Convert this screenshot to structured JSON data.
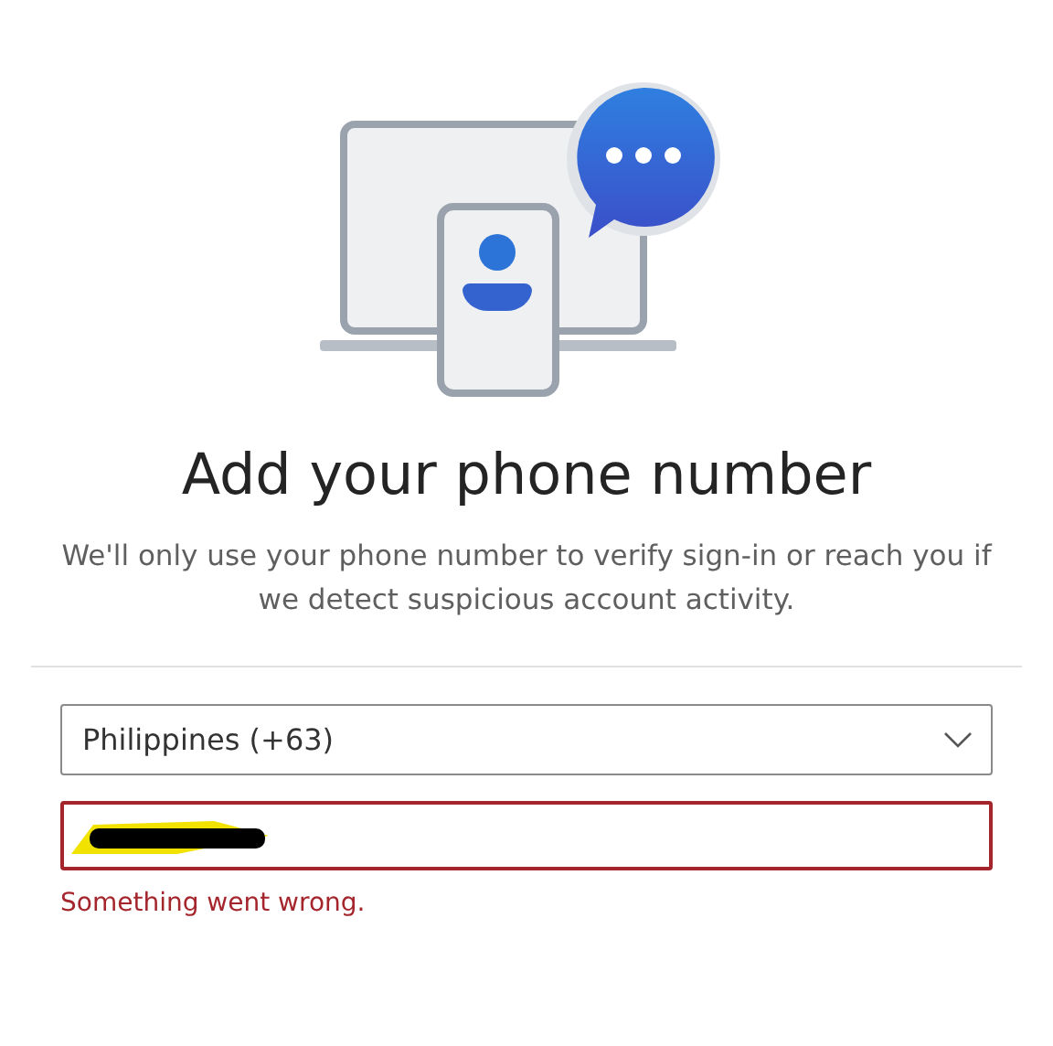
{
  "heading": "Add your phone number",
  "description": "We'll only use your phone number to verify sign-in or reach you if we detect suspicious account activity.",
  "country_select": {
    "value": "Philippines (+63)"
  },
  "phone_field": {
    "invalid": true,
    "redacted": true
  },
  "error_message": "Something went wrong."
}
